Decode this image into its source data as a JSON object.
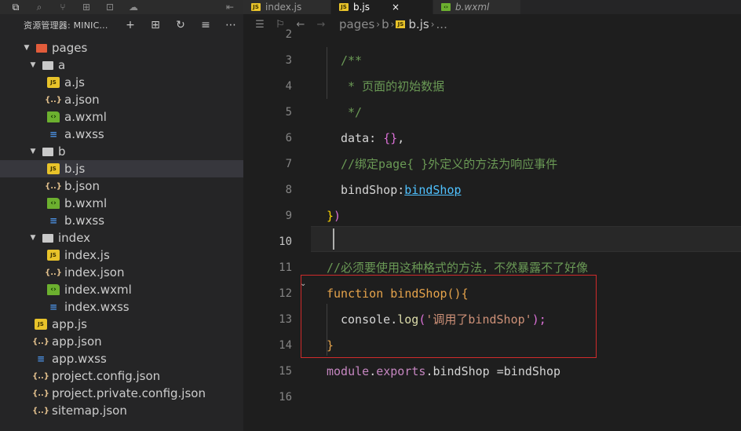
{
  "activity_bar": {
    "icons": [
      "files-icon",
      "search-icon",
      "source-control-icon",
      "extensions-icon",
      "debug-icon",
      "cloud-icon"
    ],
    "right_icon": "split-icon"
  },
  "sidebar": {
    "title": "资源管理器: MINIC...",
    "header_actions": [
      "new-file-icon",
      "new-folder-icon",
      "refresh-icon",
      "collapse-icon",
      "more-icon"
    ],
    "tree": [
      {
        "label": "pages",
        "type": "pages-folder",
        "depth": 0,
        "expanded": true
      },
      {
        "label": "a",
        "type": "folder",
        "depth": 1,
        "expanded": true
      },
      {
        "label": "a.js",
        "type": "js",
        "depth": 2
      },
      {
        "label": "a.json",
        "type": "json",
        "depth": 2
      },
      {
        "label": "a.wxml",
        "type": "wxml",
        "depth": 2
      },
      {
        "label": "a.wxss",
        "type": "wxss",
        "depth": 2
      },
      {
        "label": "b",
        "type": "folder",
        "depth": 1,
        "expanded": true
      },
      {
        "label": "b.js",
        "type": "js",
        "depth": 2,
        "selected": true
      },
      {
        "label": "b.json",
        "type": "json",
        "depth": 2
      },
      {
        "label": "b.wxml",
        "type": "wxml",
        "depth": 2
      },
      {
        "label": "b.wxss",
        "type": "wxss",
        "depth": 2
      },
      {
        "label": "index",
        "type": "folder",
        "depth": 1,
        "expanded": true
      },
      {
        "label": "index.js",
        "type": "js",
        "depth": 2
      },
      {
        "label": "index.json",
        "type": "json",
        "depth": 2
      },
      {
        "label": "index.wxml",
        "type": "wxml",
        "depth": 2
      },
      {
        "label": "index.wxss",
        "type": "wxss",
        "depth": 2
      },
      {
        "label": "app.js",
        "type": "js",
        "depth": 0
      },
      {
        "label": "app.json",
        "type": "json",
        "depth": 0
      },
      {
        "label": "app.wxss",
        "type": "wxss",
        "depth": 0
      },
      {
        "label": "project.config.json",
        "type": "json",
        "depth": 0
      },
      {
        "label": "project.private.config.json",
        "type": "json",
        "depth": 0
      },
      {
        "label": "sitemap.json",
        "type": "json",
        "depth": 0
      }
    ]
  },
  "tabs": [
    {
      "label": "index.js",
      "icon": "js",
      "active": false,
      "italic": false
    },
    {
      "label": "b.js",
      "icon": "js",
      "active": true,
      "italic": false,
      "close": "×"
    },
    {
      "label": "b.wxml",
      "icon": "wxml",
      "active": false,
      "italic": true
    }
  ],
  "breadcrumb": {
    "path": [
      "pages",
      "b"
    ],
    "file": "b.js",
    "trail": "..."
  },
  "editor": {
    "current_line": "10",
    "lines": [
      {
        "num": "2",
        "tokens": []
      },
      {
        "num": "3",
        "tokens": [
          {
            "t": "/**",
            "c": "comment"
          }
        ]
      },
      {
        "num": "4",
        "tokens": [
          {
            "t": " * 页面的初始数据",
            "c": "comment"
          }
        ]
      },
      {
        "num": "5",
        "tokens": [
          {
            "t": " */",
            "c": "comment"
          }
        ]
      },
      {
        "num": "6",
        "tokens": [
          {
            "t": "data",
            "c": "default"
          },
          {
            "t": ": ",
            "c": "default"
          },
          {
            "t": "{}",
            "c": "purple"
          },
          {
            "t": ",",
            "c": "default"
          }
        ]
      },
      {
        "num": "7",
        "tokens": [
          {
            "t": "//绑定page{ }外定义的方法为响应事件",
            "c": "comment"
          }
        ]
      },
      {
        "num": "8",
        "tokens": [
          {
            "t": "bindShop",
            "c": "default"
          },
          {
            "t": ":",
            "c": "default"
          },
          {
            "t": "bindShop",
            "c": "link"
          }
        ]
      },
      {
        "num": "9",
        "tokens": [
          {
            "t": "}",
            "c": "brace"
          },
          {
            "t": ")",
            "c": "purple"
          }
        ]
      },
      {
        "num": "10",
        "tokens": []
      },
      {
        "num": "11",
        "tokens": [
          {
            "t": "//必须要使用这种格式的方法，不然暴露不了好像",
            "c": "comment"
          }
        ]
      },
      {
        "num": "12",
        "tokens": [
          {
            "t": "function",
            "c": "kw-orange"
          },
          {
            "t": " ",
            "c": "default"
          },
          {
            "t": "bindShop",
            "c": "kw-orange"
          },
          {
            "t": "(){",
            "c": "kw-orange"
          }
        ]
      },
      {
        "num": "13",
        "tokens": [
          {
            "t": "console",
            "c": "default"
          },
          {
            "t": ".",
            "c": "default"
          },
          {
            "t": "log",
            "c": "fn"
          },
          {
            "t": "(",
            "c": "purple"
          },
          {
            "t": "'调用了bindShop'",
            "c": "string"
          },
          {
            "t": ");",
            "c": "purple"
          }
        ]
      },
      {
        "num": "14",
        "tokens": [
          {
            "t": "}",
            "c": "kw-orange"
          }
        ]
      },
      {
        "num": "15",
        "tokens": [
          {
            "t": "module",
            "c": "module"
          },
          {
            "t": ".",
            "c": "default"
          },
          {
            "t": "exports",
            "c": "module"
          },
          {
            "t": ".bindShop =bindShop",
            "c": "default"
          }
        ]
      },
      {
        "num": "16",
        "tokens": []
      }
    ]
  }
}
